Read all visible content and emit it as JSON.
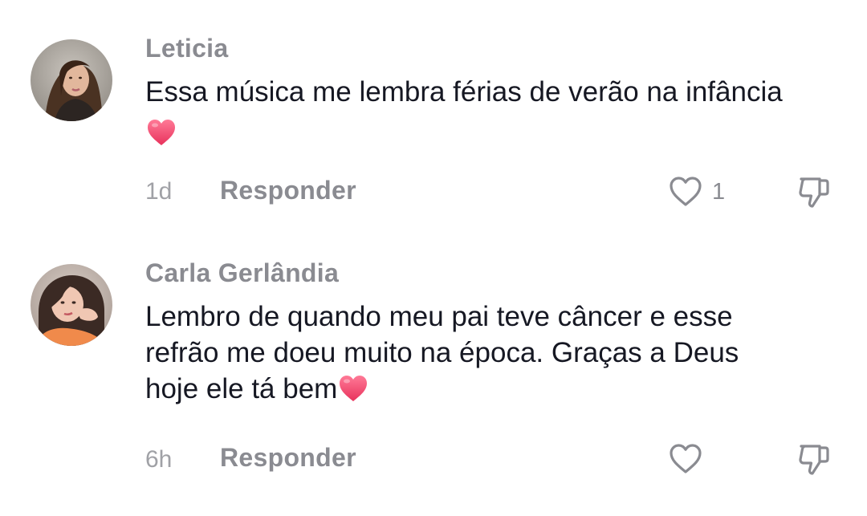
{
  "comments": [
    {
      "username": "Leticia",
      "text_lines": [
        "Essa música me lembra férias de verão na infância"
      ],
      "trailing_emoji": "heart-emoji",
      "time": "1d",
      "reply_label": "Responder",
      "like_count": "1"
    },
    {
      "username": "Carla Gerlândia",
      "text_lines": [
        "Lembro de quando meu pai teve câncer e esse",
        "refrão me doeu muito na época. Graças a Deus",
        "hoje ele tá bem"
      ],
      "trailing_emoji": "heart-emoji",
      "time": "6h",
      "reply_label": "Responder",
      "like_count": ""
    }
  ],
  "colors": {
    "username": "#8a8b91",
    "text": "#161823",
    "meta": "#a0a1a6",
    "heart_emoji": "#f2456e"
  },
  "icons": [
    "heart-outline-icon",
    "thumbs-down-icon",
    "heart-emoji"
  ]
}
